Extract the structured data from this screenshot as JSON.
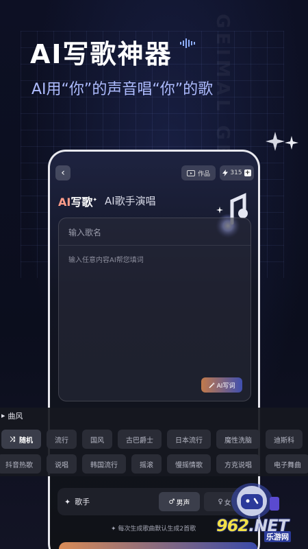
{
  "hero": {
    "title": "AI写歌神器",
    "subtitle": "AI用“你”的声音唱“你”的歌",
    "side_watermark": "GEIMAL GEIMAL"
  },
  "app": {
    "header": {
      "back_icon": "chevron-left-icon",
      "works_label": "作品",
      "energy_count": "315"
    },
    "tabs": [
      {
        "label_ai": "AI",
        "label_rest": "写歌",
        "active": true
      },
      {
        "label": "AI歌手演唱",
        "active": false
      }
    ],
    "form": {
      "song_name_placeholder": "输入歌名",
      "lyrics_placeholder": "输入任意内容AI帮您填词",
      "ai_write_label": "AI写词"
    }
  },
  "style": {
    "title": "曲风",
    "row1": [
      "随机",
      "流行",
      "国风",
      "古巴爵士",
      "日本流行",
      "魔性洗脑",
      "迪斯科"
    ],
    "row2": [
      "抖音热歌",
      "说唱",
      "韩国流行",
      "摇滚",
      "慢摇情歌",
      "方克说唱",
      "电子舞曲"
    ],
    "selected": "随机"
  },
  "singer": {
    "label": "歌手",
    "male": "男声",
    "female": "女",
    "selected": "男声"
  },
  "note": "每次生成歌曲默认生成2首歌",
  "watermark": {
    "brand_a": "962",
    "brand_b": ".NET",
    "sub": "乐游网"
  },
  "colors": {
    "accent_orange": "#d88b56",
    "accent_blue": "#3a4aa8",
    "subtitle": "#aebcff"
  }
}
